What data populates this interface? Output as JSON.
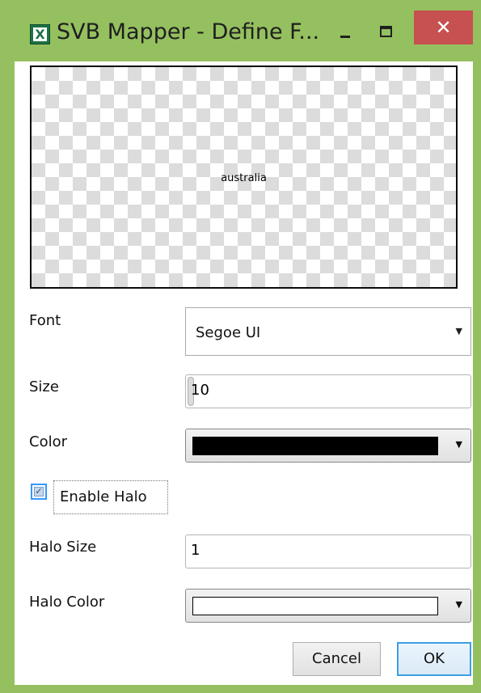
{
  "window": {
    "title": "SVB Mapper - Define F...",
    "icon": "excel-app-icon",
    "close_glyph": "✕",
    "frame_color": "#95c05f",
    "close_color": "#c75050"
  },
  "preview": {
    "sample_text": "australia"
  },
  "form": {
    "font_label": "Font",
    "font_value": "Segoe UI",
    "size_label": "Size",
    "size_value": "10",
    "color_label": "Color",
    "color_value": "#000000",
    "enable_halo_label": "Enable Halo",
    "enable_halo_checked": true,
    "halo_size_label": "Halo Size",
    "halo_size_value": "1",
    "halo_color_label": "Halo Color",
    "halo_color_value": "#ffffff"
  },
  "buttons": {
    "cancel": "Cancel",
    "ok": "OK"
  }
}
